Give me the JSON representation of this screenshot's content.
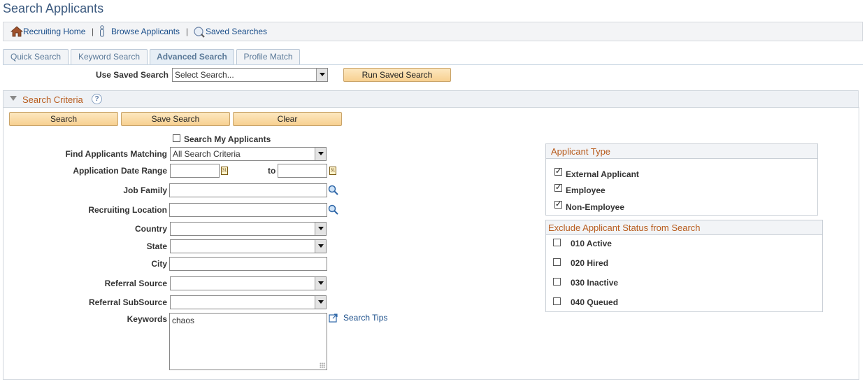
{
  "page": {
    "title": "Search Applicants"
  },
  "nav": {
    "recruiting_home": "Recruiting Home",
    "browse_applicants": "Browse Applicants",
    "saved_searches": "Saved Searches",
    "separator": "|"
  },
  "tabs": [
    {
      "label": "Quick Search",
      "active": false
    },
    {
      "label": "Keyword Search",
      "active": false
    },
    {
      "label": "Advanced Search",
      "active": true
    },
    {
      "label": "Profile Match",
      "active": false
    }
  ],
  "saved_search": {
    "label": "Use Saved Search",
    "value": "Select Search...",
    "run_button": "Run Saved Search"
  },
  "criteria": {
    "title": "Search Criteria",
    "help": "?",
    "buttons": {
      "search": "Search",
      "save": "Save Search",
      "clear": "Clear"
    },
    "search_my_applicants": "Search My Applicants",
    "find_matching": {
      "label": "Find Applicants Matching",
      "value": "All Search Criteria"
    },
    "date_range": {
      "label": "Application Date Range",
      "to": "to",
      "cal": "31"
    },
    "job_family": {
      "label": "Job Family",
      "value": ""
    },
    "recruiting_location": {
      "label": "Recruiting Location",
      "value": ""
    },
    "country": {
      "label": "Country",
      "value": ""
    },
    "state": {
      "label": "State",
      "value": ""
    },
    "city": {
      "label": "City",
      "value": ""
    },
    "referral_source": {
      "label": "Referral Source",
      "value": ""
    },
    "referral_subsource": {
      "label": "Referral SubSource",
      "value": ""
    },
    "keywords": {
      "label": "Keywords",
      "value": "chaos",
      "tips": "Search Tips"
    }
  },
  "applicant_type": {
    "title": "Applicant Type",
    "items": [
      {
        "label": "External Applicant",
        "checked": true
      },
      {
        "label": "Employee",
        "checked": true
      },
      {
        "label": "Non-Employee",
        "checked": true
      }
    ]
  },
  "exclude_status": {
    "title": "Exclude Applicant Status from Search",
    "items": [
      {
        "label": "010 Active",
        "checked": false
      },
      {
        "label": "020 Hired",
        "checked": false
      },
      {
        "label": "030 Inactive",
        "checked": false
      },
      {
        "label": "040 Queued",
        "checked": false
      }
    ]
  },
  "icons": {
    "home": "home-icon",
    "browse": "person-icon",
    "saved": "saved-search-icon",
    "lookup": "magnifier-icon",
    "calendar": "calendar-icon",
    "external_link": "external-link-icon"
  },
  "colors": {
    "title": "#3c5a7f",
    "link": "#1a4e8a",
    "group_title": "#b85c1e",
    "button": "#f7d090"
  }
}
